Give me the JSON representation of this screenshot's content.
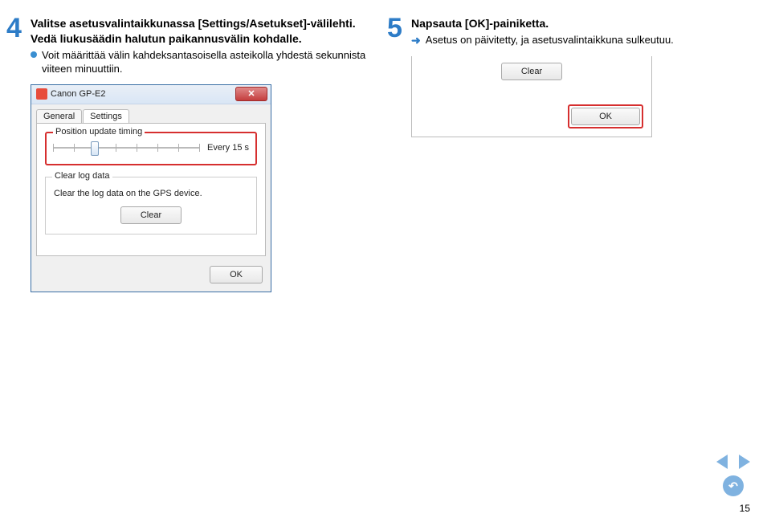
{
  "step4": {
    "number": "4",
    "heading_prefix": "Valitse asetusvalintaikkunassa [Settings/Asetukset]-välilehti. Vedä liukusäädin halutun paikannusvälin kohdalle.",
    "bullet": "Voit määrittää välin kahdeksantasoisella asteikolla yhdestä sekunnista viiteen minuuttiin.",
    "dialog": {
      "title": "Canon GP-E2",
      "tabs": {
        "general": "General",
        "settings": "Settings"
      },
      "group1_legend": "Position update timing",
      "slider_label": "Every 15 s",
      "group2_legend": "Clear log data",
      "group2_text": "Clear the log data on the GPS device.",
      "clear_btn": "Clear",
      "ok_btn": "OK"
    }
  },
  "step5": {
    "number": "5",
    "heading": "Napsauta [OK]-painiketta.",
    "arrow_text": "Asetus on päivitetty, ja asetusvalintaikkuna sulkeutuu.",
    "dialog": {
      "clear_btn": "Clear",
      "ok_btn": "OK"
    }
  },
  "page_number": "15"
}
